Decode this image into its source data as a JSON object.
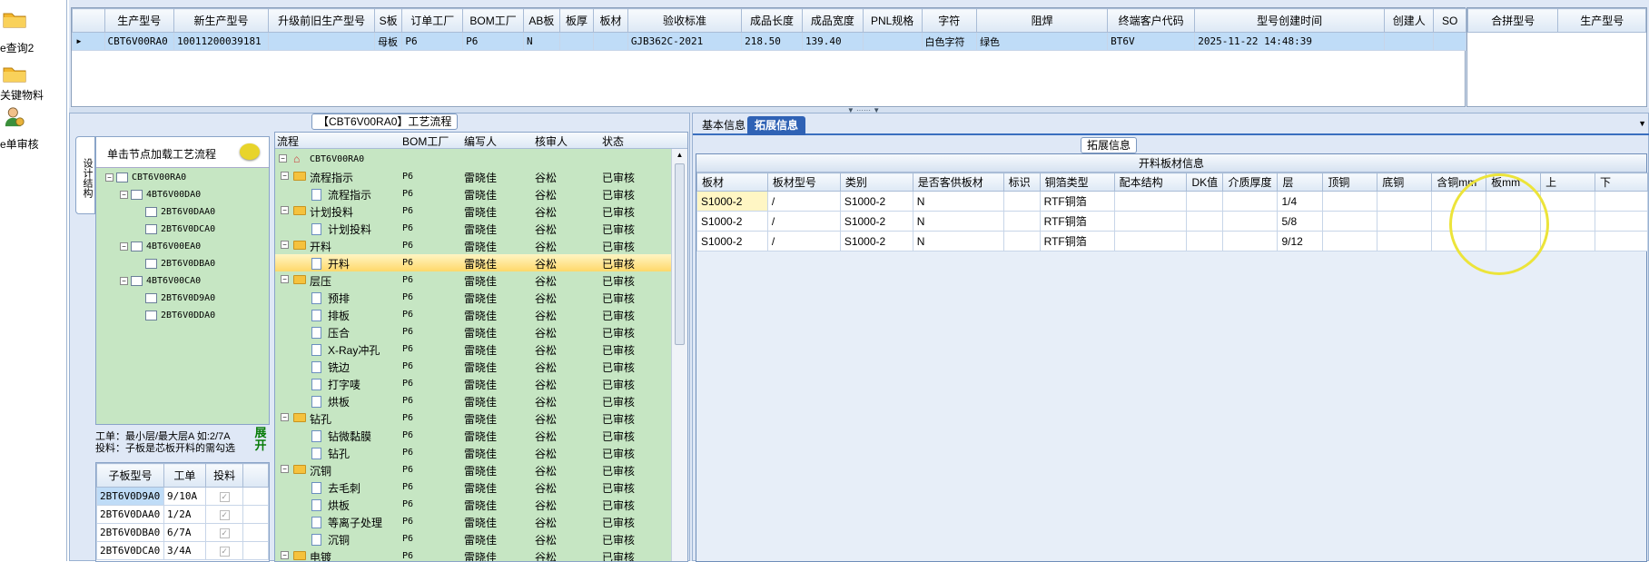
{
  "leftbar": {
    "items": [
      {
        "label": "e查询2",
        "icon": "folder-icon"
      },
      {
        "label": "关键物料",
        "icon": "folder-icon"
      },
      {
        "label": "e单审核",
        "icon": "user-icon"
      }
    ]
  },
  "top_grid": {
    "columns": [
      "生产型号",
      "新生产型号",
      "升级前旧生产型号",
      "S板",
      "订单工厂",
      "BOM工厂",
      "AB板",
      "板厚",
      "板材",
      "验收标准",
      "成品长度",
      "成品宽度",
      "PNL规格",
      "字符",
      "阻焊",
      "终端客户代码",
      "型号创建时间",
      "创建人",
      "SO"
    ],
    "rows": [
      [
        "CBT6V00RA0",
        "10011200039181",
        "",
        "母板",
        "P6",
        "P6",
        "N",
        "",
        "",
        "GJB362C-2021",
        "218.50",
        "139.40",
        "",
        "白色字符",
        "绿色",
        "BT6V",
        "2025-11-22 14:48:39",
        "",
        ""
      ]
    ]
  },
  "right_grid": {
    "columns": [
      "合拼型号",
      "生产型号"
    ]
  },
  "process_panel": {
    "title": "【CBT6V00RA0】工艺流程",
    "vertical_tab": "设计结构",
    "tree_header": "单击节点加载工艺流程",
    "tree": [
      {
        "label": "CBT6V00RA0",
        "level": 0
      },
      {
        "label": "4BT6V00DA0",
        "level": 1
      },
      {
        "label": "2BT6V0DAA0",
        "level": 2
      },
      {
        "label": "2BT6V0DCA0",
        "level": 2
      },
      {
        "label": "4BT6V00EA0",
        "level": 1
      },
      {
        "label": "2BT6V0DBA0",
        "level": 2
      },
      {
        "label": "4BT6V00CA0",
        "level": 1
      },
      {
        "label": "2BT6V0D9A0",
        "level": 2
      },
      {
        "label": "2BT6V0DDA0",
        "level": 2
      }
    ],
    "info_line1": "工单：最小层/最大层A 如:2/7A",
    "info_line2": "投料：子板是芯板开料的需勾选",
    "expand_label": "展开",
    "sub_grid": {
      "columns": [
        "子板型号",
        "工单",
        "投料"
      ],
      "rows": [
        [
          "2BT6V0D9A0",
          "9/10A"
        ],
        [
          "2BT6V0DAA0",
          "1/2A"
        ],
        [
          "2BT6V0DBA0",
          "6/7A"
        ],
        [
          "2BT6V0DCA0",
          "3/4A"
        ]
      ]
    },
    "flow_columns": [
      "流程",
      "BOM工厂",
      "编写人",
      "核审人",
      "状态"
    ],
    "flow_root": "CBT6V00RA0",
    "flow_rows": [
      {
        "name": "流程指示",
        "folder": true,
        "level": 1
      },
      {
        "name": "流程指示",
        "folder": false,
        "level": 2
      },
      {
        "name": "计划投料",
        "folder": true,
        "level": 1
      },
      {
        "name": "计划投料",
        "folder": false,
        "level": 2
      },
      {
        "name": "开料",
        "folder": true,
        "level": 1
      },
      {
        "name": "开料",
        "folder": false,
        "level": 2,
        "selected": true
      },
      {
        "name": "层压",
        "folder": true,
        "level": 1
      },
      {
        "name": "预排",
        "folder": false,
        "level": 2
      },
      {
        "name": "排板",
        "folder": false,
        "level": 2
      },
      {
        "name": "压合",
        "folder": false,
        "level": 2
      },
      {
        "name": "X-Ray冲孔",
        "folder": false,
        "level": 2
      },
      {
        "name": "铣边",
        "folder": false,
        "level": 2
      },
      {
        "name": "打字唛",
        "folder": false,
        "level": 2
      },
      {
        "name": "烘板",
        "folder": false,
        "level": 2
      },
      {
        "name": "钻孔",
        "folder": true,
        "level": 1
      },
      {
        "name": "钻微黏膜",
        "folder": false,
        "level": 2
      },
      {
        "name": "钻孔",
        "folder": false,
        "level": 2
      },
      {
        "name": "沉铜",
        "folder": true,
        "level": 1
      },
      {
        "name": "去毛刺",
        "folder": false,
        "level": 2
      },
      {
        "name": "烘板",
        "folder": false,
        "level": 2
      },
      {
        "name": "等离子处理",
        "folder": false,
        "level": 2
      },
      {
        "name": "沉铜",
        "folder": false,
        "level": 2
      },
      {
        "name": "电镀",
        "folder": true,
        "level": 1
      }
    ],
    "flow_common": {
      "factory": "P6",
      "writer": "雷晓佳",
      "reviewer": "谷松",
      "status": "已审核"
    }
  },
  "detail_panel": {
    "tabs": [
      "基本信息",
      "拓展信息"
    ],
    "active_tab": "拓展信息",
    "group_title": "拓展信息",
    "table_title": "开料板材信息",
    "columns": [
      "板材",
      "板材型号",
      "类别",
      "是否客供板材",
      "标识",
      "铜箔类型",
      "配本结构",
      "DK值",
      "介质厚度",
      "层",
      "顶铜",
      "底铜",
      "含铜mm",
      "板mm",
      "上",
      "下"
    ],
    "rows": [
      [
        "S1000-2",
        "/",
        "S1000-2",
        "N",
        "",
        "RTF铜箔",
        "",
        "",
        "",
        "1/4",
        "",
        "",
        "",
        "",
        "",
        ""
      ],
      [
        "S1000-2",
        "/",
        "S1000-2",
        "N",
        "",
        "RTF铜箔",
        "",
        "",
        "",
        "5/8",
        "",
        "",
        "",
        "",
        "",
        ""
      ],
      [
        "S1000-2",
        "/",
        "S1000-2",
        "N",
        "",
        "RTF铜箔",
        "",
        "",
        "",
        "9/12",
        "",
        "",
        "",
        "",
        "",
        ""
      ]
    ]
  },
  "colors": {
    "selection": "#bfdcf7",
    "tree_bg": "#c6e6c3",
    "active_tab": "#2f62b5",
    "highlight_circle": "#ece43a"
  }
}
